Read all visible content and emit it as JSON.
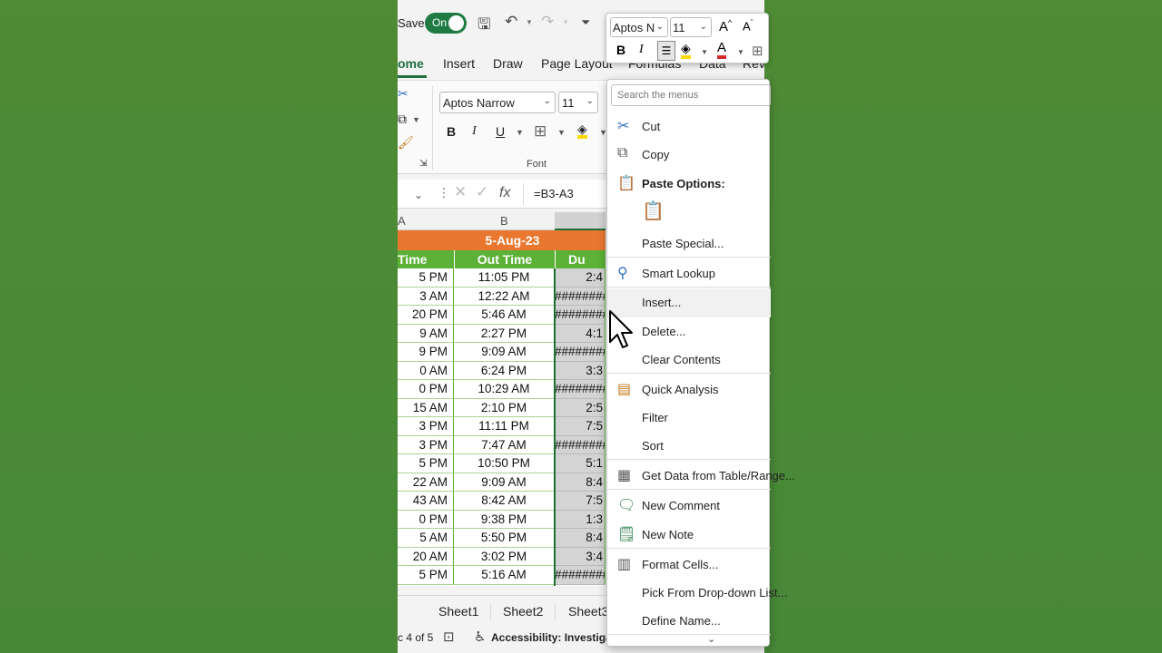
{
  "titlebar": {
    "autosave_label": "Save",
    "toggle_label": "On"
  },
  "ribbon_tabs": [
    "ome",
    "Insert",
    "Draw",
    "Page Layout",
    "Formulas",
    "Data",
    "Rev"
  ],
  "ribbon": {
    "font_name": "Aptos Narrow",
    "font_size": "11",
    "group_label": "Font",
    "bold": "B",
    "italic": "I",
    "underline": "U"
  },
  "formula_bar": {
    "fx": "fx",
    "formula": "=B3-A3"
  },
  "columns": [
    "A",
    "B"
  ],
  "table": {
    "date_header": "5-Aug-23",
    "headers": [
      "Time",
      "Out Time",
      "Du"
    ],
    "rows": [
      [
        "5 PM",
        "11:05 PM",
        "2:4"
      ],
      [
        "3 AM",
        "12:22 AM",
        "########"
      ],
      [
        "20 PM",
        "5:46 AM",
        "########"
      ],
      [
        "9 AM",
        "2:27 PM",
        "4:1"
      ],
      [
        "9 PM",
        "9:09 AM",
        "########"
      ],
      [
        "0 AM",
        "6:24 PM",
        "3:3"
      ],
      [
        "0 PM",
        "10:29 AM",
        "########"
      ],
      [
        "15 AM",
        "2:10 PM",
        "2:5"
      ],
      [
        "3 PM",
        "11:11 PM",
        "7:5"
      ],
      [
        "3 PM",
        "7:47 AM",
        "########"
      ],
      [
        "5 PM",
        "10:50 PM",
        "5:1"
      ],
      [
        "22 AM",
        "9:09 AM",
        "8:4"
      ],
      [
        "43 AM",
        "8:42 AM",
        "7:5"
      ],
      [
        "0 PM",
        "9:38 PM",
        "1:3"
      ],
      [
        "5 AM",
        "5:50 PM",
        "8:4"
      ],
      [
        "20 AM",
        "3:02 PM",
        "3:4"
      ],
      [
        "5 PM",
        "5:16 AM",
        "########"
      ]
    ]
  },
  "sheet_tabs": [
    "Sheet1",
    "Sheet2",
    "Sheet3"
  ],
  "status": {
    "record": "c 4 of 5",
    "accessibility": "Accessibility: Investigat"
  },
  "mini_toolbar": {
    "font_name": "Aptos N",
    "font_size": "11",
    "grow": "A",
    "shrink": "A",
    "bold": "B",
    "italic": "I",
    "font_color": "A"
  },
  "context_menu": {
    "search_placeholder": "Search the menus",
    "items": {
      "cut": "Cut",
      "copy": "Copy",
      "paste_options": "Paste Options:",
      "paste_special": "Paste Special...",
      "smart_lookup": "Smart Lookup",
      "insert": "Insert...",
      "delete": "Delete...",
      "clear_contents": "Clear Contents",
      "quick_analysis": "Quick Analysis",
      "filter": "Filter",
      "sort": "Sort",
      "get_data": "Get Data from Table/Range...",
      "new_comment": "New Comment",
      "new_note": "New Note",
      "format_cells": "Format Cells...",
      "pick_dropdown": "Pick From Drop-down List...",
      "define_name": "Define Name..."
    }
  },
  "colors": {
    "accent_green": "#1f6e3f",
    "header_orange": "#e9772f",
    "header_green": "#5bb237",
    "background": "#4a8a35"
  }
}
